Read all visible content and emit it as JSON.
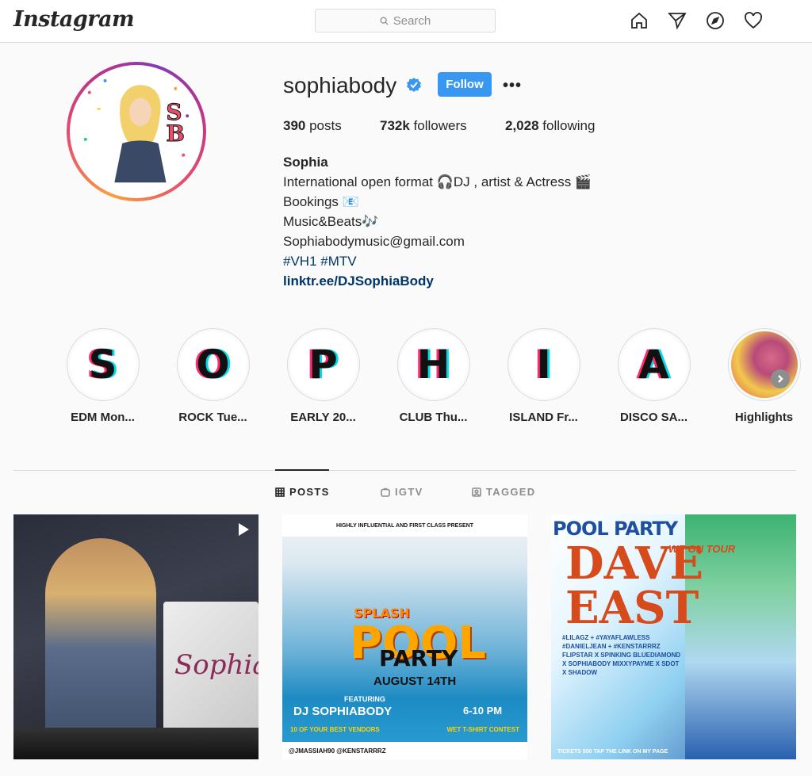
{
  "nav": {
    "logo": "Instagram",
    "search_placeholder": "Search"
  },
  "profile": {
    "username": "sophiabody",
    "follow_label": "Follow",
    "more_label": "•••",
    "stats": {
      "posts_count": "390",
      "posts_label": " posts",
      "followers_count": "732k",
      "followers_label": " followers",
      "following_count": "2,028",
      "following_label": " following"
    },
    "bio": {
      "name": "Sophia",
      "line1": "International open format 🎧DJ , artist & Actress 🎬",
      "line2": "Bookings 📧",
      "line3": "Music&Beats🎶",
      "line4": "Sophiabodymusic@gmail.com",
      "hashtags": "#VH1 #MTV",
      "link": "linktr.ee/DJSophiaBody"
    }
  },
  "highlights": [
    {
      "letter": "S",
      "label": "EDM Mon..."
    },
    {
      "letter": "O",
      "label": "ROCK Tue..."
    },
    {
      "letter": "P",
      "label": "EARLY 20..."
    },
    {
      "letter": "H",
      "label": "CLUB Thu..."
    },
    {
      "letter": "I",
      "label": "ISLAND Fr..."
    },
    {
      "letter": "A",
      "label": "DISCO SA..."
    },
    {
      "letter": "",
      "label": "Highlights"
    }
  ],
  "tabs": {
    "posts": "POSTS",
    "igtv": "IGTV",
    "tagged": "TAGGED"
  },
  "posts": {
    "post1": {
      "sign_text": "Sophia"
    },
    "post2": {
      "top": "HIGHLY INFLUENTIAL AND FIRST CLASS PRESENT",
      "title1": "SPLASH",
      "title2": "POOL",
      "title3": "PARTY",
      "date": "AUGUST 14TH",
      "featuring": "FEATURING",
      "dj": "DJ SOPHIABODY",
      "time": "6-10 PM",
      "left_bar": "10 OF YOUR BEST VENDORS",
      "right_bar": "WET T-SHIRT CONTEST",
      "footer": "@JMASSIAH90 @KENSTARRRZ"
    },
    "post3": {
      "pool": "POOL PARTY",
      "dave": "DAVE EAST",
      "tour": "WE ON TOUR",
      "lines": "#LILAGZ + #YAYAFLAWLESS #DANIELJEAN + #KENSTARRRZ FLIPSTAR X SPINKING BLUEDIAMOND X SOPHIABODY MIXXYPAYME X SDOT X SHADOW",
      "footer": "TICKETS $50 TAP THE LINK ON MY PAGE"
    }
  },
  "colors": {
    "follow_button": "#3897f0",
    "link": "#003569",
    "border": "#dbdbdb",
    "muted": "#8e8e8e"
  }
}
